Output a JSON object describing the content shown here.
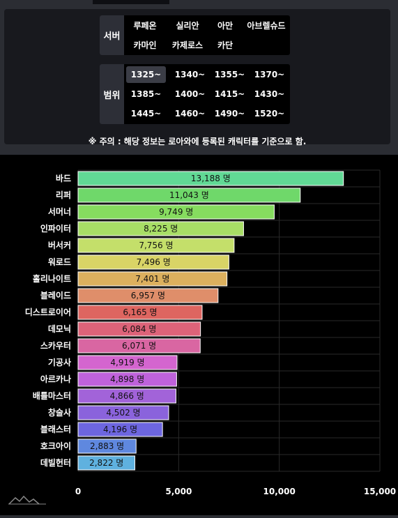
{
  "filters": {
    "server": {
      "label": "서버",
      "options": [
        "루페온",
        "실리안",
        "아만",
        "아브렐슈드",
        "카마인",
        "카제로스",
        "카단"
      ]
    },
    "range": {
      "label": "범위",
      "options": [
        "1325~",
        "1340~",
        "1355~",
        "1370~",
        "1385~",
        "1400~",
        "1415~",
        "1430~",
        "1445~",
        "1460~",
        "1490~",
        "1520~"
      ],
      "selected": "1325~"
    },
    "notice": "※ 주의 : 해당 정보는 로아와에 등록된 캐릭터를 기준으로 함."
  },
  "chart_data": {
    "type": "bar",
    "orientation": "horizontal",
    "categories": [
      "바드",
      "리퍼",
      "서머너",
      "인파이터",
      "버서커",
      "워로드",
      "홀리나이트",
      "블레이드",
      "디스트로이어",
      "데모닉",
      "스카우터",
      "기공사",
      "아르카나",
      "배틀마스터",
      "창술사",
      "블래스터",
      "호크아이",
      "데빌헌터"
    ],
    "values": [
      13188,
      11043,
      9749,
      8225,
      7756,
      7496,
      7401,
      6957,
      6165,
      6084,
      6071,
      4919,
      4898,
      4866,
      4502,
      4196,
      2883,
      2822
    ],
    "value_labels": [
      "13,188 명",
      "11,043 명",
      "9,749 명",
      "8,225 명",
      "7,756 명",
      "7,496 명",
      "7,401 명",
      "6,957 명",
      "6,165 명",
      "6,084 명",
      "6,071 명",
      "4,919 명",
      "4,898 명",
      "4,866 명",
      "4,502 명",
      "4,196 명",
      "2,883 명",
      "2,822 명"
    ],
    "colors": [
      "#61d995",
      "#6fd86a",
      "#86dc5f",
      "#a8de66",
      "#c4df6a",
      "#d9d466",
      "#dcb05e",
      "#df8e6a",
      "#de6560",
      "#dd6379",
      "#d966a2",
      "#d465cf",
      "#bf62db",
      "#a263d9",
      "#8a63dc",
      "#6d66e0",
      "#5f88df",
      "#5fb1df"
    ],
    "xlim": [
      0,
      15000
    ],
    "xticks": [
      0,
      5000,
      10000,
      15000
    ],
    "xtick_labels": [
      "0",
      "5,000",
      "10,000",
      "15,000"
    ],
    "grid": true
  }
}
